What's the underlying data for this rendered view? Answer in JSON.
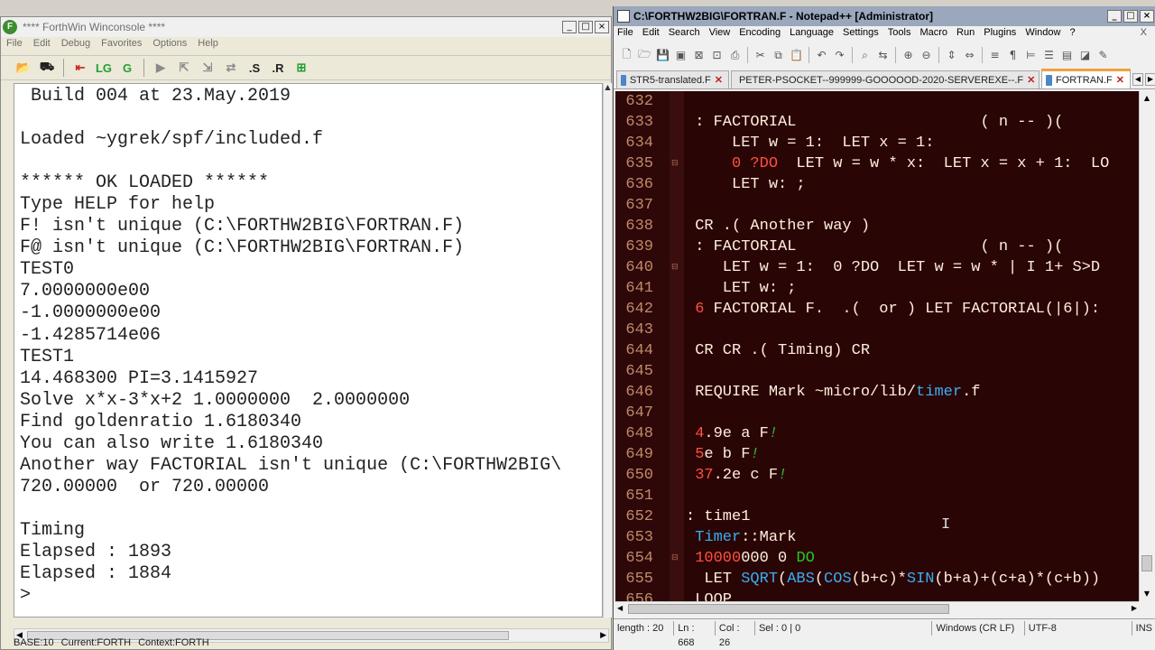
{
  "forthwin": {
    "title": "**** ForthWin Winconsole ****",
    "menu": [
      "File",
      "Edit",
      "Debug",
      "Favorites",
      "Options",
      "Help"
    ],
    "toolbar": [
      "open-icon",
      "save-icon",
      "stop-icon",
      "load-green-icon",
      "load-green2-icon",
      "run-icon",
      "step-into-icon",
      "step-over-icon",
      "step-out-icon",
      ".S",
      ".R",
      "export-icon"
    ],
    "console_lines": [
      " Build 004 at 23.May.2019",
      "",
      "Loaded ~ygrek/spf/included.f",
      "",
      "****** OK LOADED ******",
      "Type HELP for help",
      "F! isn't unique (C:\\FORTHW2BIG\\FORTRAN.F)",
      "F@ isn't unique (C:\\FORTHW2BIG\\FORTRAN.F)",
      "TEST0",
      "7.0000000e00",
      "-1.0000000e00",
      "-1.4285714e06",
      "TEST1",
      "14.468300 PI=3.1415927",
      "Solve x*x-3*x+2 1.0000000  2.0000000",
      "Find goldenratio 1.6180340",
      "You can also write 1.6180340",
      "Another way FACTORIAL isn't unique (C:\\FORTHW2BIG\\",
      "720.00000  or 720.00000",
      "",
      "Timing",
      "Elapsed : 1893",
      "Elapsed : 1884",
      ">"
    ],
    "status": {
      "base": "BASE:10",
      "current": "Current:FORTH",
      "context": "Context:FORTH"
    }
  },
  "notepad": {
    "title": "C:\\FORTHW2BIG\\FORTRAN.F - Notepad++ [Administrator]",
    "menu": [
      "File",
      "Edit",
      "Search",
      "View",
      "Encoding",
      "Language",
      "Settings",
      "Tools",
      "Macro",
      "Run",
      "Plugins",
      "Window",
      "?"
    ],
    "close_x": "X",
    "tabs": [
      {
        "label": "STR5-translated.F",
        "active": false
      },
      {
        "label": "PETER-PSOCKET--999999-GOOOOOD-2020-SERVEREXE--.F",
        "active": false
      },
      {
        "label": "FORTRAN.F",
        "active": true
      }
    ],
    "lines": [
      {
        "n": "632",
        "fold": "",
        "tokens": [
          [
            "",
            ""
          ]
        ]
      },
      {
        "n": "633",
        "fold": "",
        "tokens": [
          [
            "w",
            " : FACTORIAL                    ( n -- )( "
          ]
        ]
      },
      {
        "n": "634",
        "fold": "",
        "tokens": [
          [
            "w",
            "     LET w = 1:  LET x = 1:"
          ]
        ]
      },
      {
        "n": "635",
        "fold": "⊟",
        "tokens": [
          [
            "n",
            "     0 "
          ],
          [
            "n",
            "?DO"
          ],
          [
            "w",
            "  LET w = w * x:  LET x = x + 1:  LO"
          ]
        ]
      },
      {
        "n": "636",
        "fold": "",
        "tokens": [
          [
            "w",
            "     LET w: ;"
          ]
        ]
      },
      {
        "n": "637",
        "fold": "",
        "tokens": [
          [
            "",
            ""
          ]
        ]
      },
      {
        "n": "638",
        "fold": "",
        "tokens": [
          [
            "w",
            " CR .( Another way )"
          ]
        ]
      },
      {
        "n": "639",
        "fold": "",
        "tokens": [
          [
            "w",
            " : FACTORIAL                    ( n -- )( "
          ]
        ]
      },
      {
        "n": "640",
        "fold": "⊟",
        "tokens": [
          [
            "w",
            "    LET w = 1:  0 ?DO  LET w = w * | I 1+ S>D"
          ]
        ]
      },
      {
        "n": "641",
        "fold": "",
        "tokens": [
          [
            "w",
            "    LET w: ;"
          ]
        ]
      },
      {
        "n": "642",
        "fold": "",
        "tokens": [
          [
            "n",
            " 6"
          ],
          [
            "w",
            " FACTORIAL F.  .(  or ) LET FACTORIAL(|6|):"
          ]
        ]
      },
      {
        "n": "643",
        "fold": "",
        "tokens": [
          [
            "",
            ""
          ]
        ]
      },
      {
        "n": "644",
        "fold": "",
        "tokens": [
          [
            "w",
            " CR CR .( Timing) CR"
          ]
        ]
      },
      {
        "n": "645",
        "fold": "",
        "tokens": [
          [
            "",
            ""
          ]
        ]
      },
      {
        "n": "646",
        "fold": "",
        "tokens": [
          [
            "w",
            " REQUIRE Mark ~micro/lib/"
          ],
          [
            "b",
            "timer"
          ],
          [
            "w",
            ".f"
          ]
        ]
      },
      {
        "n": "647",
        "fold": "",
        "tokens": [
          [
            "",
            ""
          ]
        ]
      },
      {
        "n": "648",
        "fold": "",
        "tokens": [
          [
            "n",
            " 4"
          ],
          [
            "w",
            ".9e a F"
          ],
          [
            "gr",
            "!"
          ]
        ]
      },
      {
        "n": "649",
        "fold": "",
        "tokens": [
          [
            "n",
            " 5"
          ],
          [
            "w",
            "e b F"
          ],
          [
            "gr",
            "!"
          ]
        ]
      },
      {
        "n": "650",
        "fold": "",
        "tokens": [
          [
            "n",
            " 37"
          ],
          [
            "w",
            ".2e c F"
          ],
          [
            "gr",
            "!"
          ]
        ]
      },
      {
        "n": "651",
        "fold": "",
        "tokens": [
          [
            "",
            ""
          ]
        ]
      },
      {
        "n": "652",
        "fold": "",
        "tokens": [
          [
            "w",
            ": time1"
          ]
        ]
      },
      {
        "n": "653",
        "fold": "",
        "tokens": [
          [
            "b",
            " Timer"
          ],
          [
            "w",
            "::Mark"
          ]
        ]
      },
      {
        "n": "654",
        "fold": "⊟",
        "tokens": [
          [
            "n",
            " 10000"
          ],
          [
            "w",
            "000 0 "
          ],
          [
            "g",
            "DO"
          ]
        ]
      },
      {
        "n": "655",
        "fold": "",
        "tokens": [
          [
            "w",
            "  LET "
          ],
          [
            "b",
            "SQRT"
          ],
          [
            "w",
            "("
          ],
          [
            "b",
            "ABS"
          ],
          [
            "w",
            "("
          ],
          [
            "b",
            "COS"
          ],
          [
            "w",
            "(b+c)*"
          ],
          [
            "b",
            "SIN"
          ],
          [
            "w",
            "(b+a)+(c+a)*(c+b))"
          ]
        ]
      },
      {
        "n": "656",
        "fold": "",
        "tokens": [
          [
            "w",
            " LOOP"
          ]
        ]
      }
    ],
    "status": {
      "length": "length : 20",
      "ln": "Ln : 668",
      "col": "Col : 26",
      "sel": "Sel : 0 | 0",
      "eol": "Windows (CR LF)",
      "encoding": "UTF-8",
      "mode": "INS"
    }
  }
}
